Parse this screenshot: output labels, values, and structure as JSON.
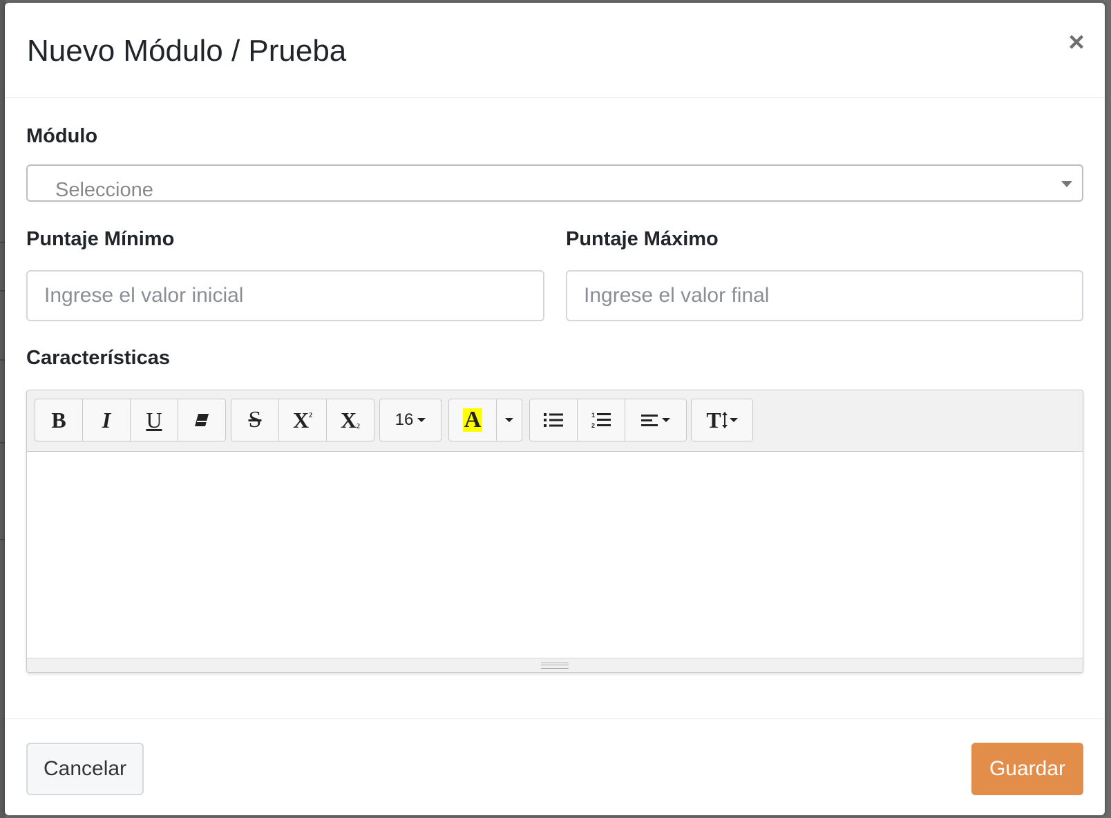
{
  "modal": {
    "title": "Nuevo Módulo / Prueba",
    "close_label": "×"
  },
  "form": {
    "module": {
      "label": "Módulo",
      "placeholder": "Seleccione"
    },
    "min_score": {
      "label": "Puntaje Mínimo",
      "placeholder": "Ingrese el valor inicial"
    },
    "max_score": {
      "label": "Puntaje Máximo",
      "placeholder": "Ingrese el valor final"
    },
    "features": {
      "label": "Características"
    }
  },
  "editor": {
    "toolbar": {
      "bold": "B",
      "italic": "I",
      "underline": "U",
      "strikethrough": "S",
      "superscript": "X",
      "subscript": "X",
      "font_size": "16",
      "color_letter": "A",
      "highlight_color": "#ffff00",
      "icons": [
        "bold-icon",
        "italic-icon",
        "underline-icon",
        "eraser-icon",
        "strikethrough-icon",
        "superscript-icon",
        "subscript-icon",
        "font-size-dropdown",
        "text-color-icon",
        "color-dropdown-caret-icon",
        "unordered-list-icon",
        "ordered-list-icon",
        "align-dropdown-icon",
        "line-height-dropdown-icon"
      ]
    }
  },
  "footer": {
    "cancel_label": "Cancelar",
    "save_label": "Guardar"
  },
  "colors": {
    "accent": "#e38d4b"
  }
}
